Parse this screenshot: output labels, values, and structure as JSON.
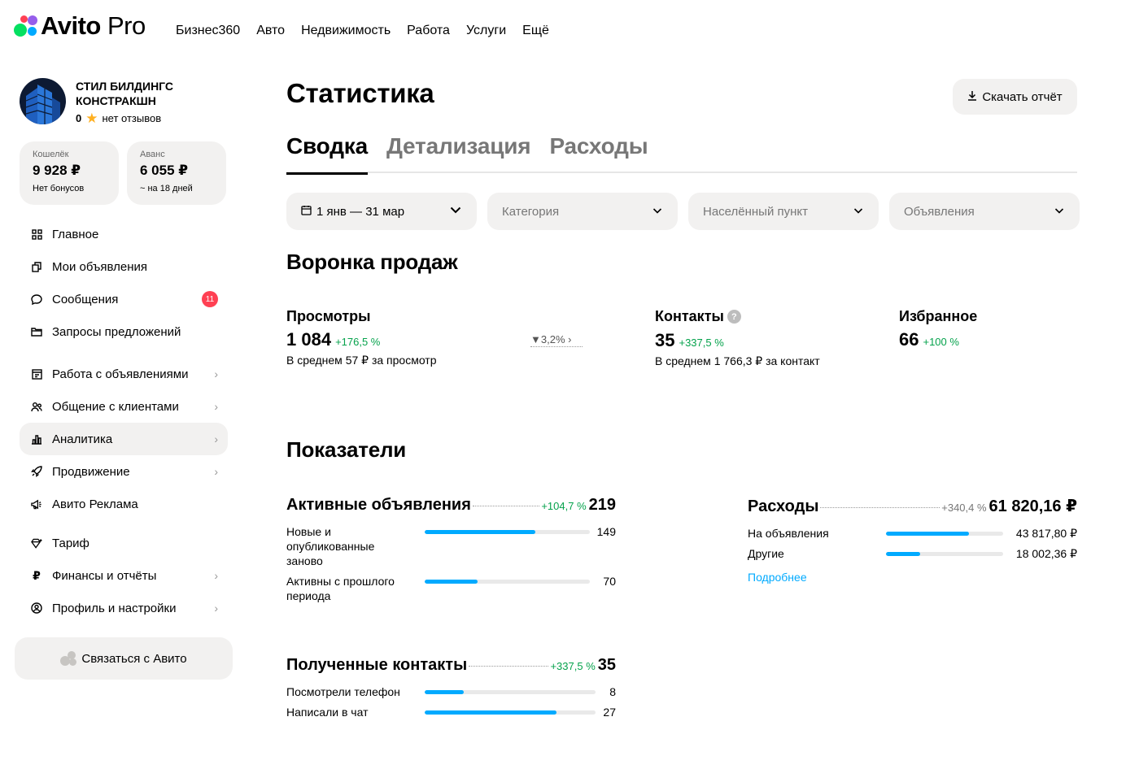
{
  "brand": {
    "name": "Avito",
    "suffix": "Pro"
  },
  "topnav": [
    "Бизнес360",
    "Авто",
    "Недвижимость",
    "Работа",
    "Услуги",
    "Ещё"
  ],
  "company": {
    "name": "СТИЛ БИЛДИНГС КОНСТРАКШН",
    "rating": "0",
    "reviews": "нет отзывов"
  },
  "wallet": {
    "label": "Кошелёк",
    "value": "9 928 ₽",
    "sub": "Нет бонусов"
  },
  "advance": {
    "label": "Аванс",
    "value": "6 055 ₽",
    "sub": "~ на 18 дней"
  },
  "menu": {
    "main": "Главное",
    "ads": "Мои объявления",
    "messages": "Сообщения",
    "messages_badge": "11",
    "requests": "Запросы предложений",
    "work_ads": "Работа с объявлениями",
    "clients": "Общение с клиентами",
    "analytics": "Аналитика",
    "promotion": "Продвижение",
    "avito_ads": "Авито Реклама",
    "tariff": "Тариф",
    "finance": "Финансы и отчёты",
    "profile": "Профиль и настройки"
  },
  "contact_button": "Связаться с Авито",
  "page_title": "Статистика",
  "download_button": "Скачать отчёт",
  "tabs": [
    "Сводка",
    "Детализация",
    "Расходы"
  ],
  "filters": {
    "date": "1 янв — 31 мар",
    "category": "Категория",
    "city": "Населённый пункт",
    "ads": "Объявления"
  },
  "funnel": {
    "title": "Воронка продаж",
    "views": {
      "name": "Просмотры",
      "value": "1 084",
      "delta": "+176,5 %",
      "note": "В среднем 57 ₽ за просмотр"
    },
    "conversion": "3,2%",
    "contacts": {
      "name": "Контакты",
      "value": "35",
      "delta": "+337,5 %",
      "note": "В среднем 1 766,3 ₽ за контакт"
    },
    "favorites": {
      "name": "Избранное",
      "value": "66",
      "delta": "+100 %"
    }
  },
  "indicators": {
    "title": "Показатели",
    "active_ads": {
      "title": "Активные объявления",
      "delta": "+104,7 %",
      "total": "219",
      "rows": [
        {
          "label": "Новые и опубликованные заново",
          "value": "149",
          "fill": 0.67
        },
        {
          "label": "Активны с прошлого периода",
          "value": "70",
          "fill": 0.32
        }
      ]
    },
    "expenses": {
      "title": "Расходы",
      "delta": "+340,4 %",
      "total": "61 820,16 ₽",
      "rows": [
        {
          "label": "На объявления",
          "value": "43 817,80 ₽",
          "fill": 0.71
        },
        {
          "label": "Другие",
          "value": "18 002,36 ₽",
          "fill": 0.29
        }
      ],
      "link": "Подробнее"
    },
    "contacts": {
      "title": "Полученные контакты",
      "delta": "+337,5 %",
      "total": "35",
      "rows": [
        {
          "label": "Посмотрели телефон",
          "value": "8",
          "fill": 0.23
        },
        {
          "label": "Написали в чат",
          "value": "27",
          "fill": 0.77
        }
      ]
    }
  },
  "colors": {
    "accent": "#00aaff",
    "positive": "#05a24c",
    "badge": "#ff4053",
    "surface": "#f2f1f0"
  }
}
